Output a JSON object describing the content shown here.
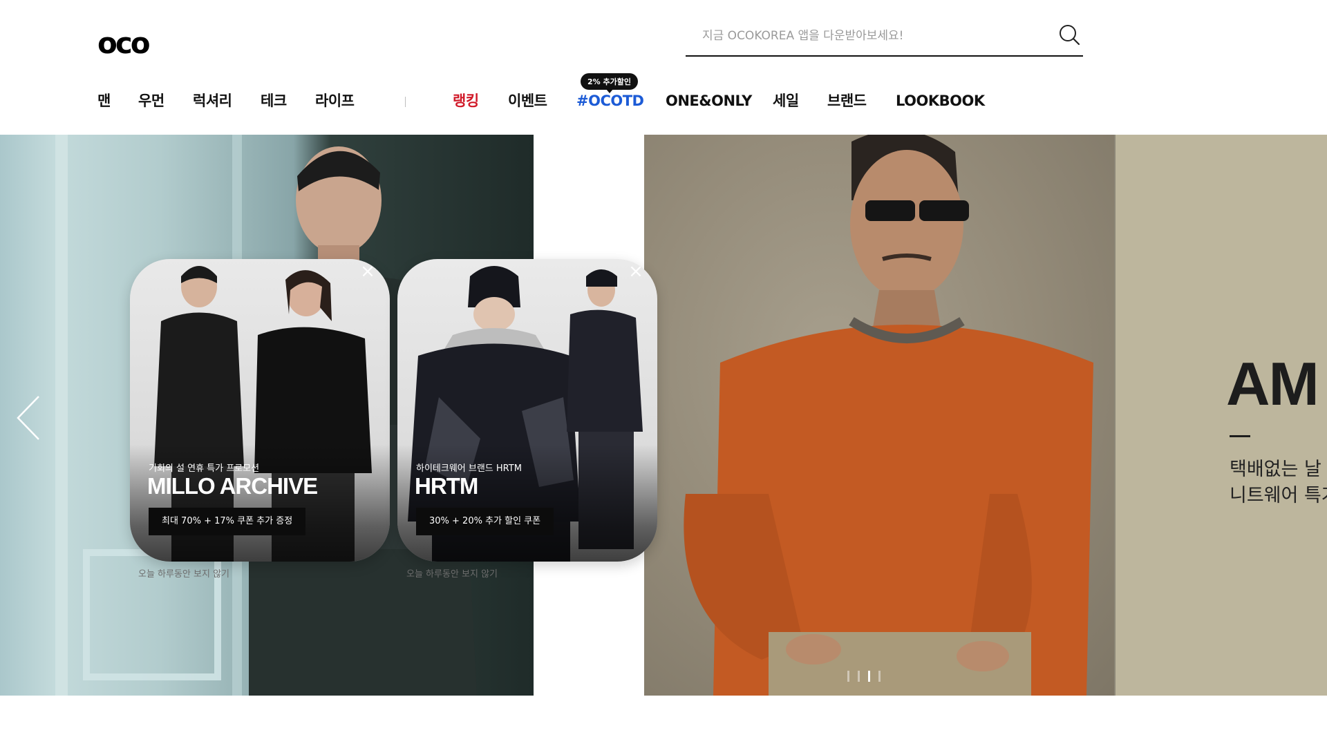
{
  "logo": {
    "text": "oco"
  },
  "search": {
    "placeholder": "지금 OCOKOREA 앱을 다운받아보세요!",
    "icon": "search-icon"
  },
  "nav": {
    "items": [
      {
        "label": "맨"
      },
      {
        "label": "우먼"
      },
      {
        "label": "럭셔리"
      },
      {
        "label": "테크"
      },
      {
        "label": "라이프"
      },
      {
        "label": "랭킹",
        "color": "#d11b2a"
      },
      {
        "label": "이벤트"
      },
      {
        "label": "#OCOTD",
        "color": "#1c5bd6",
        "badge": "2% 추가할인"
      },
      {
        "label": "ONE&ONLY"
      },
      {
        "label": "세일"
      },
      {
        "label": "브랜드"
      },
      {
        "label": "LOOKBOOK"
      }
    ]
  },
  "banner": {
    "right_slide": {
      "title": "AM",
      "line1": "택배없는 날",
      "line2": "니트웨어 특가"
    },
    "pagination": {
      "count": 4,
      "active": 3
    }
  },
  "popups": [
    {
      "subtitle": "기회의 설 연휴 특가 프로모션",
      "title": "MILLO ARCHIVE",
      "cta": "최대 70% + 17% 쿠폰 추가 증정",
      "hide_label": "오늘 하루동안 보지 않기",
      "close": "×"
    },
    {
      "subtitle": "하이테크웨어 브랜드 HRTM",
      "title": "HRTM",
      "cta": "30% + 20% 추가 할인 쿠폰",
      "hide_label": "오늘 하루동안 보지 않기",
      "close": "×"
    }
  ],
  "colors": {
    "accent_red": "#d11b2a",
    "accent_blue": "#1c5bd6",
    "popup_cta_bg": "#0c0c0c"
  }
}
